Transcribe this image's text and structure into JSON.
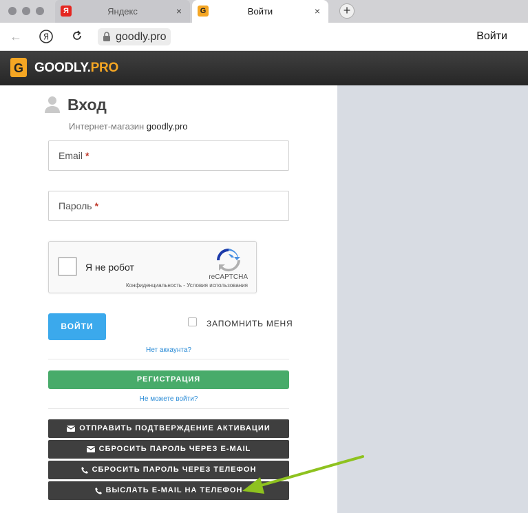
{
  "browser": {
    "tabs": [
      {
        "title": "Яндекс",
        "favicon": "yandex-favicon",
        "favicon_text": "Я",
        "active": false
      },
      {
        "title": "Войти",
        "favicon": "goodly-favicon",
        "favicon_text": "G",
        "active": true
      }
    ],
    "url": "goodly.pro",
    "toolbar_login": "Войти"
  },
  "site": {
    "logo_main": "GOODLY.",
    "logo_accent": "PRO",
    "logo_letter": "G",
    "accent_color": "#f5a623"
  },
  "login": {
    "title": "Вход",
    "subtitle_prefix": "Интернет-магазин",
    "subtitle_shop": "goodly.pro",
    "email_placeholder": "Email",
    "password_placeholder": "Пароль",
    "required_mark": "*",
    "captcha_label": "Я не робот",
    "captcha_brand": "reCAPTCHA",
    "captcha_legal": "Конфиденциальность - Условия использования",
    "login_button": "ВОЙТИ",
    "remember_label": "ЗАПОМНИТЬ МЕНЯ",
    "no_account_link": "Нет аккаунта?",
    "register_button": "РЕГИСТРАЦИЯ",
    "cant_login_link": "Не можете войти?",
    "action_buttons": [
      {
        "label": "ОТПРАВИТЬ ПОДТВЕРЖДЕНИЕ АКТИВАЦИИ",
        "icon": "envelope-icon"
      },
      {
        "label": "СБРОСИТЬ ПАРОЛЬ ЧЕРЕЗ E-MAIL",
        "icon": "envelope-icon"
      },
      {
        "label": "СБРОСИТЬ ПАРОЛЬ ЧЕРЕЗ ТЕЛЕФОН",
        "icon": "phone-icon"
      },
      {
        "label": "ВЫСЛАТЬ E-MAIL НА ТЕЛЕФОН",
        "icon": "phone-icon"
      }
    ]
  },
  "colors": {
    "login_button": "#3ba9ec",
    "register_button": "#48ab6a",
    "dark_button": "#3f3f3f",
    "annotation_arrow": "#8ec21f",
    "side_panel": "#d8dce3"
  }
}
